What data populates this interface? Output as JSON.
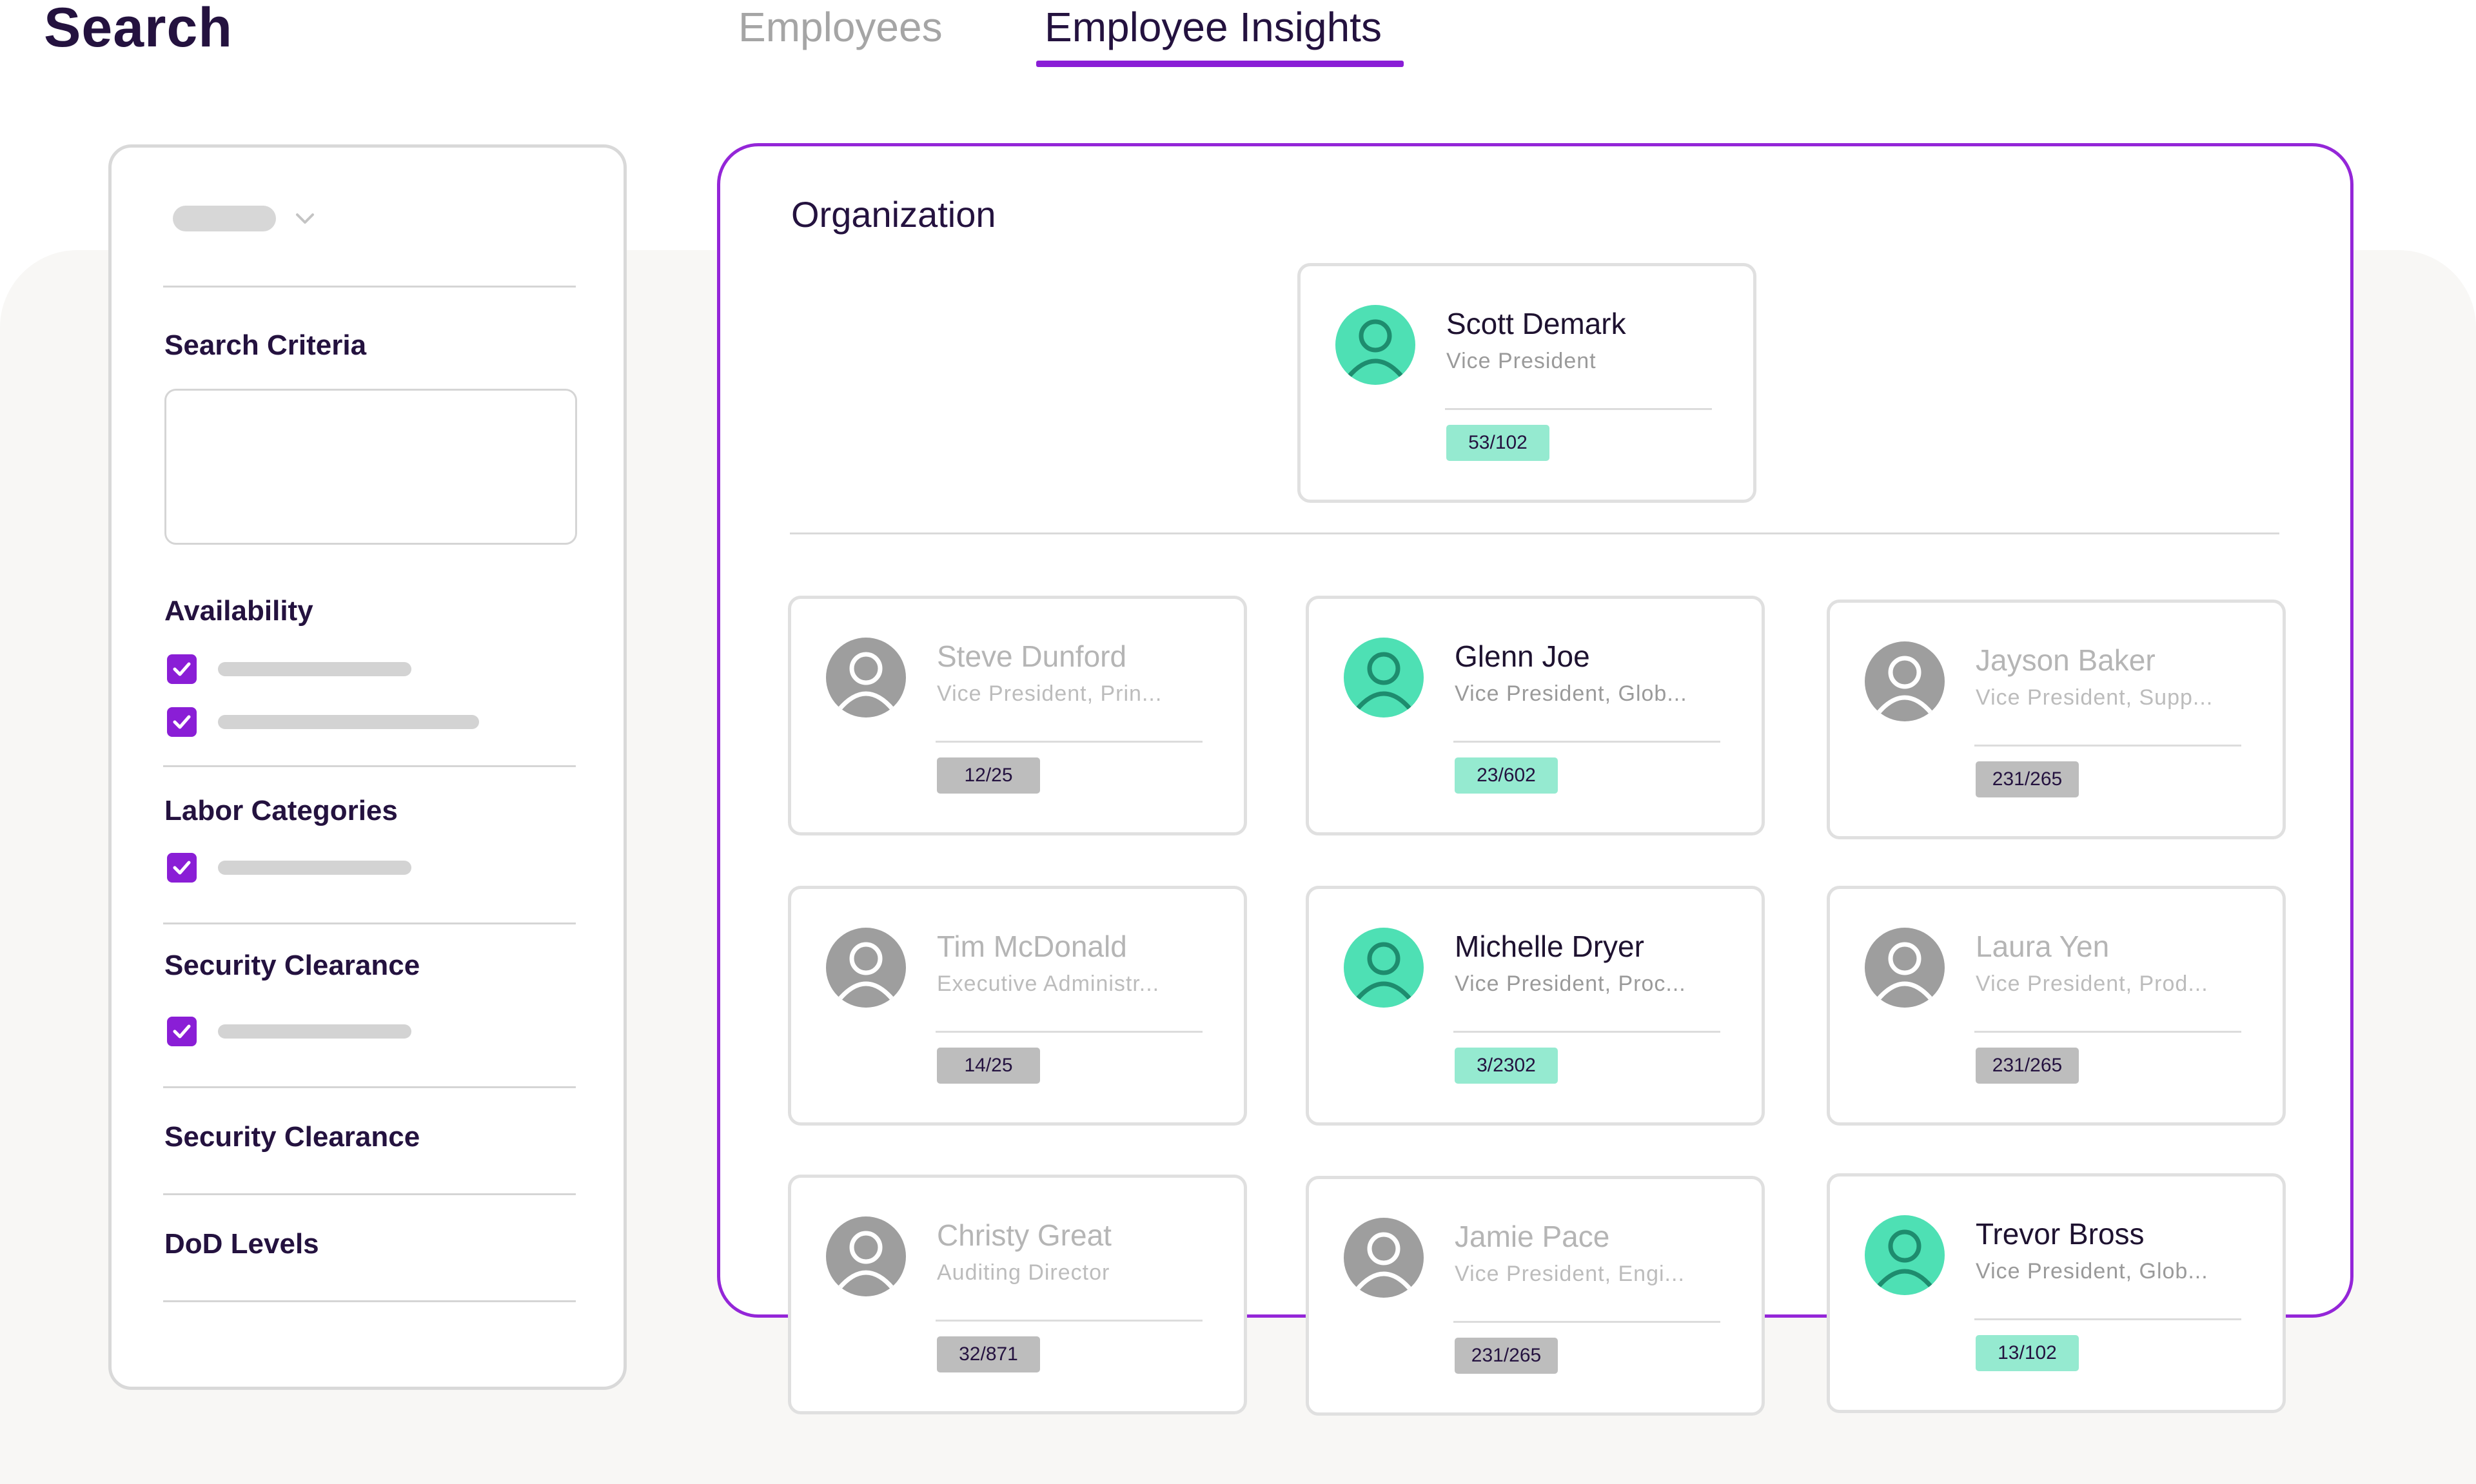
{
  "header": {
    "title": "Search",
    "tabs": [
      {
        "label": "Employees",
        "active": false
      },
      {
        "label": "Employee Insights",
        "active": true
      }
    ]
  },
  "filters": {
    "sections": [
      {
        "label": "Search Criteria"
      },
      {
        "label": "Availability"
      },
      {
        "label": "Labor Categories"
      },
      {
        "label": "Security Clearance"
      },
      {
        "label": "Security Clearance"
      },
      {
        "label": "DoD Levels"
      }
    ]
  },
  "organization": {
    "title": "Organization",
    "leader": {
      "name": "Scott Demark",
      "title": "Vice President",
      "badge": "53/102",
      "active": true
    },
    "employees": [
      {
        "name": "Steve Dunford",
        "title": "Vice President, Prin...",
        "badge": "12/25",
        "active": false
      },
      {
        "name": "Glenn Joe",
        "title": "Vice President, Glob...",
        "badge": "23/602",
        "active": true
      },
      {
        "name": "Jayson Baker",
        "title": "Vice President, Supp...",
        "badge": "231/265",
        "active": false
      },
      {
        "name": "Tim McDonald",
        "title": "Executive Administr...",
        "badge": "14/25",
        "active": false
      },
      {
        "name": "Michelle Dryer",
        "title": "Vice President, Proc...",
        "badge": "3/2302",
        "active": true
      },
      {
        "name": "Laura Yen",
        "title": "Vice President, Prod...",
        "badge": "231/265",
        "active": false
      },
      {
        "name": "Christy Great",
        "title": "Auditing Director",
        "badge": "32/871",
        "active": false
      },
      {
        "name": "Jamie Pace",
        "title": "Vice President, Engi...",
        "badge": "231/265",
        "active": false
      },
      {
        "name": "Trevor Bross",
        "title": "Vice President, Glob...",
        "badge": "13/102",
        "active": true
      }
    ]
  },
  "colors": {
    "accent": "#8a1ed6",
    "active_avatar": "#4ee0b4",
    "active_badge": "#95ead0",
    "inactive_badge": "#bdbdbd",
    "text_dark": "#24123f"
  }
}
